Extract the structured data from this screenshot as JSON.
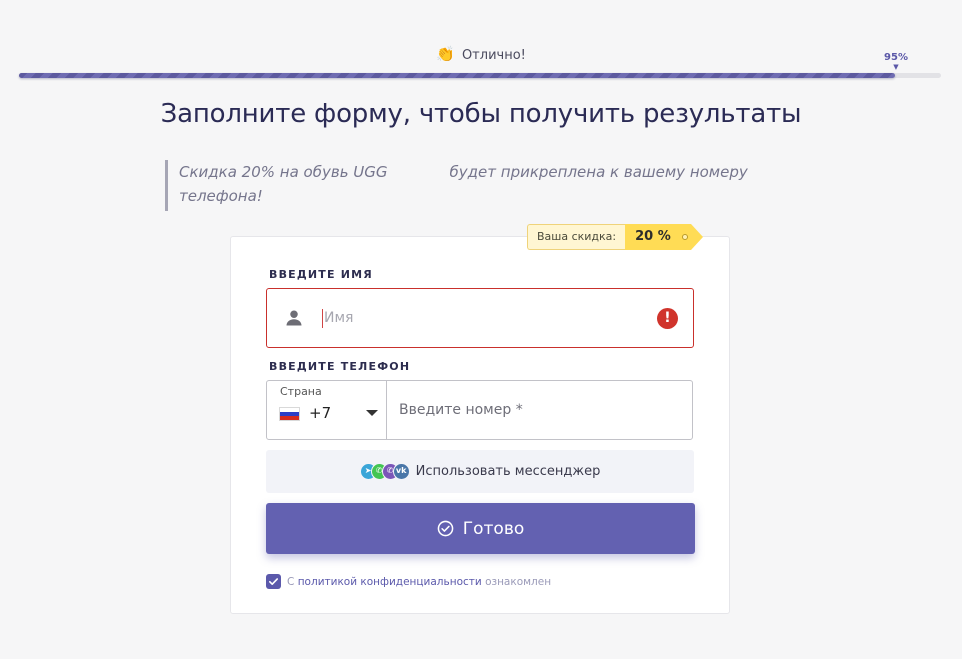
{
  "progress": {
    "label": "Отлично!",
    "emoji": "👏",
    "percent_text": "95%",
    "value": 0.95
  },
  "title": "Заполните форму, чтобы получить результаты",
  "promo": {
    "text_before": "Скидка 20% на обувь UGG",
    "text_after": "будет прикреплена к вашему номеру телефона!"
  },
  "discount": {
    "label": "Ваша скидка:",
    "value": "20 %"
  },
  "name_field": {
    "label": "ВВЕДИТЕ ИМЯ",
    "placeholder": "Имя",
    "icon": "person-icon",
    "error_icon": "error-icon"
  },
  "phone_field": {
    "label": "ВВЕДИТЕ ТЕЛЕФОН",
    "country_caption": "Страна",
    "country_flag": "russia-flag",
    "country_code": "+7",
    "placeholder": "Введите номер *"
  },
  "messenger": {
    "label": "Использовать мессенджер",
    "icons": [
      {
        "name": "telegram-icon",
        "color": "#3aa5d8",
        "glyph": "➤"
      },
      {
        "name": "whatsapp-icon",
        "color": "#43c553",
        "glyph": "✆"
      },
      {
        "name": "viber-icon",
        "color": "#7b56b8",
        "glyph": "✆"
      },
      {
        "name": "vk-icon",
        "color": "#4a76a8",
        "glyph": "vk"
      }
    ]
  },
  "submit": {
    "label": "Готово"
  },
  "consent": {
    "checked": true,
    "prefix": "С",
    "link": "политикой конфиденциальности",
    "suffix": "ознакомлен"
  },
  "colors": {
    "accent": "#6361b1",
    "error": "#c9302c",
    "badge_yellow": "#ffdc55",
    "background": "#f6f6f7"
  }
}
